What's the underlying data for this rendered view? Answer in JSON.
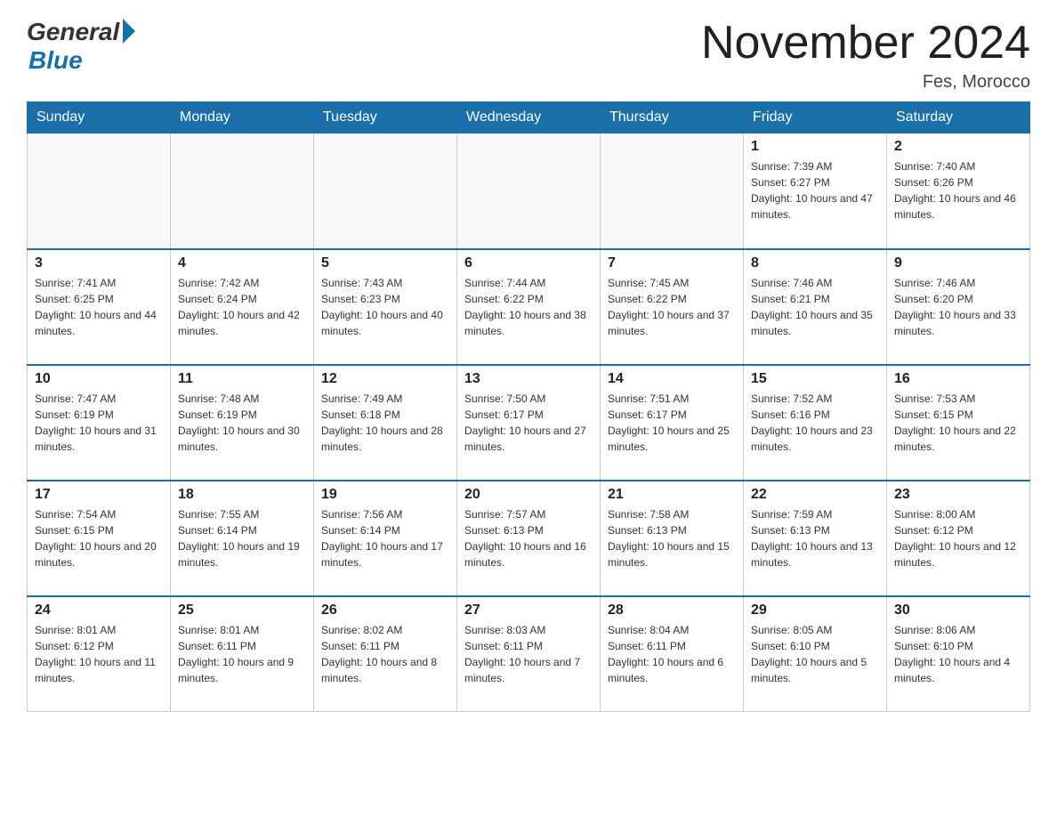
{
  "header": {
    "logo_general": "General",
    "logo_blue": "Blue",
    "title": "November 2024",
    "location": "Fes, Morocco"
  },
  "days_of_week": [
    "Sunday",
    "Monday",
    "Tuesday",
    "Wednesday",
    "Thursday",
    "Friday",
    "Saturday"
  ],
  "weeks": [
    [
      {
        "day": "",
        "info": ""
      },
      {
        "day": "",
        "info": ""
      },
      {
        "day": "",
        "info": ""
      },
      {
        "day": "",
        "info": ""
      },
      {
        "day": "",
        "info": ""
      },
      {
        "day": "1",
        "info": "Sunrise: 7:39 AM\nSunset: 6:27 PM\nDaylight: 10 hours and 47 minutes."
      },
      {
        "day": "2",
        "info": "Sunrise: 7:40 AM\nSunset: 6:26 PM\nDaylight: 10 hours and 46 minutes."
      }
    ],
    [
      {
        "day": "3",
        "info": "Sunrise: 7:41 AM\nSunset: 6:25 PM\nDaylight: 10 hours and 44 minutes."
      },
      {
        "day": "4",
        "info": "Sunrise: 7:42 AM\nSunset: 6:24 PM\nDaylight: 10 hours and 42 minutes."
      },
      {
        "day": "5",
        "info": "Sunrise: 7:43 AM\nSunset: 6:23 PM\nDaylight: 10 hours and 40 minutes."
      },
      {
        "day": "6",
        "info": "Sunrise: 7:44 AM\nSunset: 6:22 PM\nDaylight: 10 hours and 38 minutes."
      },
      {
        "day": "7",
        "info": "Sunrise: 7:45 AM\nSunset: 6:22 PM\nDaylight: 10 hours and 37 minutes."
      },
      {
        "day": "8",
        "info": "Sunrise: 7:46 AM\nSunset: 6:21 PM\nDaylight: 10 hours and 35 minutes."
      },
      {
        "day": "9",
        "info": "Sunrise: 7:46 AM\nSunset: 6:20 PM\nDaylight: 10 hours and 33 minutes."
      }
    ],
    [
      {
        "day": "10",
        "info": "Sunrise: 7:47 AM\nSunset: 6:19 PM\nDaylight: 10 hours and 31 minutes."
      },
      {
        "day": "11",
        "info": "Sunrise: 7:48 AM\nSunset: 6:19 PM\nDaylight: 10 hours and 30 minutes."
      },
      {
        "day": "12",
        "info": "Sunrise: 7:49 AM\nSunset: 6:18 PM\nDaylight: 10 hours and 28 minutes."
      },
      {
        "day": "13",
        "info": "Sunrise: 7:50 AM\nSunset: 6:17 PM\nDaylight: 10 hours and 27 minutes."
      },
      {
        "day": "14",
        "info": "Sunrise: 7:51 AM\nSunset: 6:17 PM\nDaylight: 10 hours and 25 minutes."
      },
      {
        "day": "15",
        "info": "Sunrise: 7:52 AM\nSunset: 6:16 PM\nDaylight: 10 hours and 23 minutes."
      },
      {
        "day": "16",
        "info": "Sunrise: 7:53 AM\nSunset: 6:15 PM\nDaylight: 10 hours and 22 minutes."
      }
    ],
    [
      {
        "day": "17",
        "info": "Sunrise: 7:54 AM\nSunset: 6:15 PM\nDaylight: 10 hours and 20 minutes."
      },
      {
        "day": "18",
        "info": "Sunrise: 7:55 AM\nSunset: 6:14 PM\nDaylight: 10 hours and 19 minutes."
      },
      {
        "day": "19",
        "info": "Sunrise: 7:56 AM\nSunset: 6:14 PM\nDaylight: 10 hours and 17 minutes."
      },
      {
        "day": "20",
        "info": "Sunrise: 7:57 AM\nSunset: 6:13 PM\nDaylight: 10 hours and 16 minutes."
      },
      {
        "day": "21",
        "info": "Sunrise: 7:58 AM\nSunset: 6:13 PM\nDaylight: 10 hours and 15 minutes."
      },
      {
        "day": "22",
        "info": "Sunrise: 7:59 AM\nSunset: 6:13 PM\nDaylight: 10 hours and 13 minutes."
      },
      {
        "day": "23",
        "info": "Sunrise: 8:00 AM\nSunset: 6:12 PM\nDaylight: 10 hours and 12 minutes."
      }
    ],
    [
      {
        "day": "24",
        "info": "Sunrise: 8:01 AM\nSunset: 6:12 PM\nDaylight: 10 hours and 11 minutes."
      },
      {
        "day": "25",
        "info": "Sunrise: 8:01 AM\nSunset: 6:11 PM\nDaylight: 10 hours and 9 minutes."
      },
      {
        "day": "26",
        "info": "Sunrise: 8:02 AM\nSunset: 6:11 PM\nDaylight: 10 hours and 8 minutes."
      },
      {
        "day": "27",
        "info": "Sunrise: 8:03 AM\nSunset: 6:11 PM\nDaylight: 10 hours and 7 minutes."
      },
      {
        "day": "28",
        "info": "Sunrise: 8:04 AM\nSunset: 6:11 PM\nDaylight: 10 hours and 6 minutes."
      },
      {
        "day": "29",
        "info": "Sunrise: 8:05 AM\nSunset: 6:10 PM\nDaylight: 10 hours and 5 minutes."
      },
      {
        "day": "30",
        "info": "Sunrise: 8:06 AM\nSunset: 6:10 PM\nDaylight: 10 hours and 4 minutes."
      }
    ]
  ]
}
